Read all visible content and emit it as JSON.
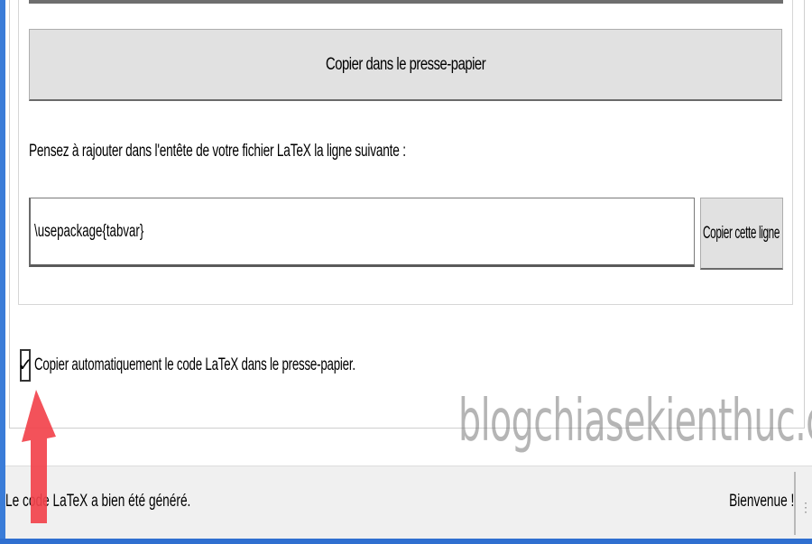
{
  "buttons": {
    "copy_clipboard": "Copier dans le presse-papier",
    "copy_line": "Copier cette ligne"
  },
  "hint": "Pensez à rajouter dans l'entête de votre fichier LaTeX la ligne suivante :",
  "package_line": {
    "value": "\\usepackage{tabvar}"
  },
  "auto_copy": {
    "checked": true,
    "check_glyph": "✓",
    "label": "Copier automatiquement le code LaTeX dans le presse-papier."
  },
  "watermark": "blogchiasekienthuc.com",
  "statusbar": {
    "message": "Le code LaTeX a bien été généré.",
    "right": "Bienvenue !"
  },
  "colors": {
    "window_border": "#3a7cd8",
    "button_face": "#e1e1e1",
    "statusbar_bg": "#f0f0f0",
    "arrow": "#f2434c"
  },
  "icons": {
    "checkbox": "checkmark-icon",
    "arrow": "red-arrow-annotation-icon",
    "grip": "resize-grip-icon"
  }
}
